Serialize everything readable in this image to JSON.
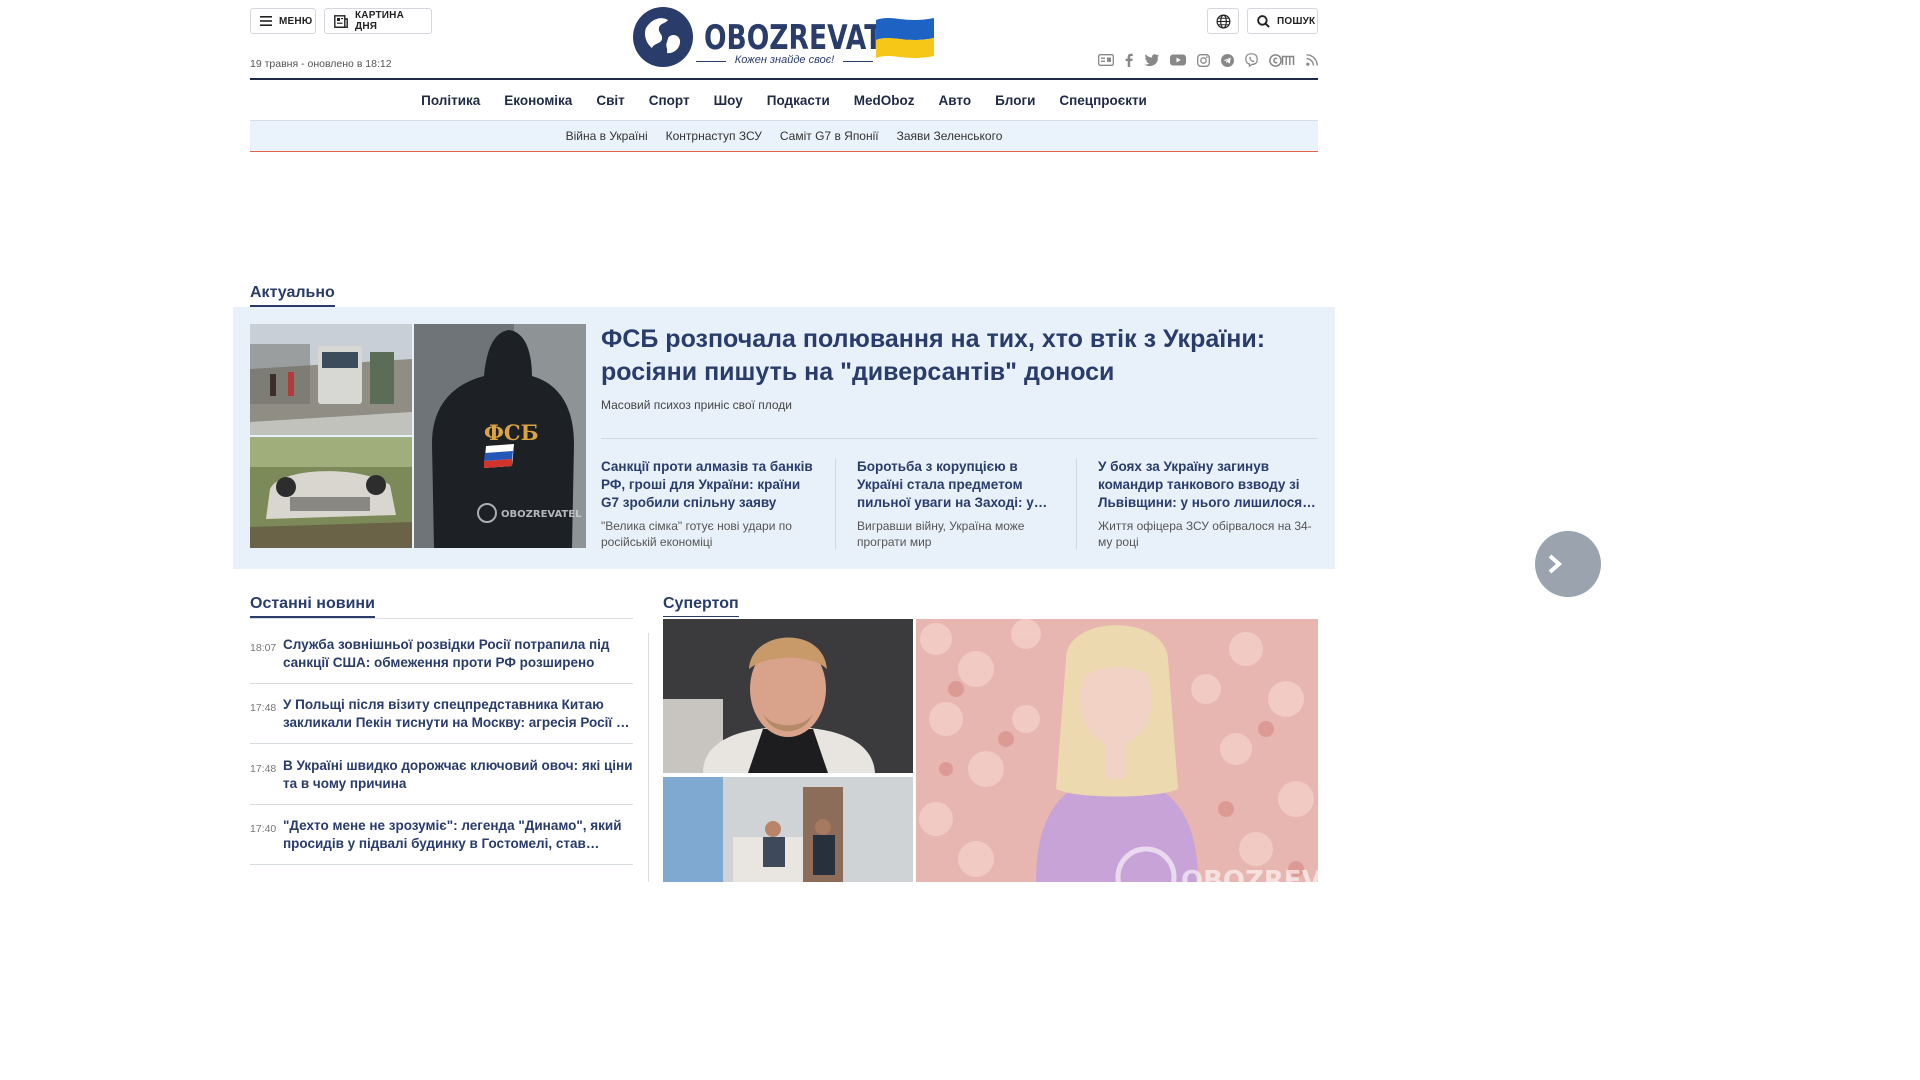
{
  "header": {
    "menu_label": "МЕНЮ",
    "picture_label": "КАРТИНА ДНЯ",
    "search_label": "ПОШУК",
    "date_text": "19 травня - оновлено в 18:12",
    "logo_text": "OBOZREVATEL",
    "slogan": "Кожен знайде своє!",
    "socials": [
      "google-news-icon",
      "facebook-icon",
      "twitter-icon",
      "youtube-icon",
      "instagram-icon",
      "telegram-icon",
      "viber-icon",
      "coub-icon",
      "rss-icon"
    ]
  },
  "nav": {
    "main": [
      "Політика",
      "Економіка",
      "Світ",
      "Спорт",
      "Шоу",
      "Подкасти",
      "MedOboz",
      "Авто",
      "Блоги",
      "Спецпроєкти"
    ],
    "sub": [
      "Війна в Україні",
      "Контрнаступ ЗСУ",
      "Саміт G7 в Японії",
      "Заяви Зеленського"
    ]
  },
  "actual": {
    "section_title": "Актуально",
    "main": {
      "title": "ФСБ розпочала полювання на тих, хто втік з України: росіяни пишуть на \"диверсантів\" доноси",
      "subtitle": "Масовий психоз приніс свої плоди",
      "image_text": "ФСБ",
      "watermark": "OBOZREVATEL"
    },
    "cards": [
      {
        "title": "Санкції проти алмазів та банків РФ, гроші для України: країни G7 зробили спільну заяву",
        "subtitle": "\"Велика сімка\" готує нові удари по російській економіці"
      },
      {
        "title": "Боротьба з корупцією в Україні стала предметом пильної уваги на Заході: у Guardian пояснили, чому",
        "subtitle": "Вигравши війну, Україна може програти мир"
      },
      {
        "title": "У боях за Україну загинув командир танкового взводу зі Львівщини: у нього лишилося двоє дітей",
        "subtitle": "Життя офіцера ЗСУ обірвалося на 34-му році"
      }
    ]
  },
  "latest": {
    "section_title": "Останні новини",
    "items": [
      {
        "time": "18:07",
        "title": "Служба зовнішньої розвідки Росії потрапила під санкції США: обмеження проти РФ розширено"
      },
      {
        "time": "17:48",
        "title": "У Польщі після візиту спецпредставника Китаю закликали Пекін тиснути на Москву: агресія Росії є загрозою"
      },
      {
        "time": "17:48",
        "title": "В Україні швидко дорожчає ключовий овоч: які ціни та в чому причина"
      },
      {
        "time": "17:40",
        "title": "\"Дехто мене не зрозуміє\": легенда \"Динамо\", який просидів у підвалі будинку в Гостомелі, став солдатом ЗСУ"
      }
    ]
  },
  "supertop": {
    "section_title": "Супертоп",
    "watermark": "OBOZREVATEL"
  },
  "colors": {
    "brand": "#293c6a",
    "accent_line": "#e0654e",
    "block_bg": "#e8f1fa",
    "flag_blue": "#1e63c4",
    "flag_yellow": "#f7c718"
  }
}
